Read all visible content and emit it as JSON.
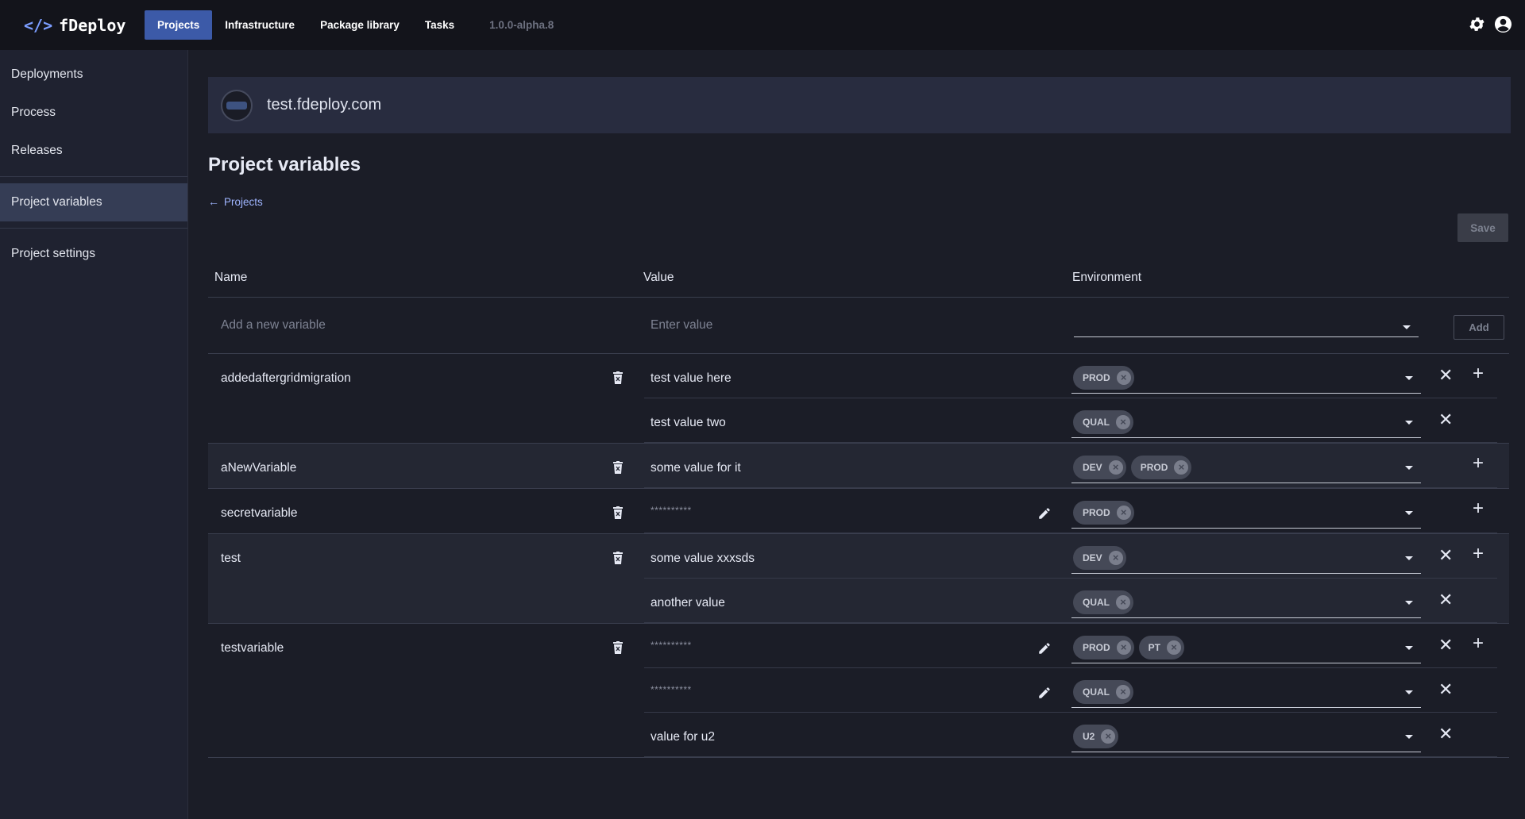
{
  "app": {
    "name": "fDeploy",
    "logo_glyph": "</>"
  },
  "nav": {
    "items": [
      {
        "label": "Projects",
        "active": true
      },
      {
        "label": "Infrastructure",
        "active": false
      },
      {
        "label": "Package library",
        "active": false
      },
      {
        "label": "Tasks",
        "active": false
      }
    ],
    "version": "1.0.0-alpha.8",
    "icons": [
      "gear-icon",
      "user-circle-icon"
    ]
  },
  "sidebar": {
    "items": [
      {
        "label": "Deployments"
      },
      {
        "label": "Process"
      },
      {
        "label": "Releases"
      },
      {
        "label": "Project variables",
        "active": true
      },
      {
        "label": "Project settings"
      }
    ]
  },
  "project": {
    "name": "test.fdeploy.com"
  },
  "page": {
    "title": "Project variables",
    "breadcrumb": "Projects",
    "save_label": "Save"
  },
  "table": {
    "headers": {
      "name": "Name",
      "value": "Value",
      "environment": "Environment"
    },
    "new_row": {
      "name_placeholder": "Add a new variable",
      "value_placeholder": "Enter value",
      "add_label": "Add"
    },
    "variables": [
      {
        "name": "addedaftergridmigration",
        "values": [
          {
            "value": "test value here",
            "secret": false,
            "environments": [
              "PROD"
            ]
          },
          {
            "value": "test value two",
            "secret": false,
            "environments": [
              "QUAL"
            ]
          }
        ]
      },
      {
        "name": "aNewVariable",
        "values": [
          {
            "value": "some value for it",
            "secret": false,
            "environments": [
              "DEV",
              "PROD"
            ]
          }
        ]
      },
      {
        "name": "secretvariable",
        "values": [
          {
            "value": "**********",
            "secret": true,
            "environments": [
              "PROD"
            ]
          }
        ]
      },
      {
        "name": "test",
        "values": [
          {
            "value": "some value xxxsds",
            "secret": false,
            "environments": [
              "DEV"
            ]
          },
          {
            "value": "another value",
            "secret": false,
            "environments": [
              "QUAL"
            ]
          }
        ]
      },
      {
        "name": "testvariable",
        "values": [
          {
            "value": "**********",
            "secret": true,
            "environments": [
              "PROD",
              "PT"
            ]
          },
          {
            "value": "**********",
            "secret": true,
            "environments": [
              "QUAL"
            ]
          },
          {
            "value": "value for u2",
            "secret": false,
            "environments": [
              "U2"
            ]
          }
        ]
      }
    ]
  },
  "colors": {
    "accent": "#3c5aa8",
    "link": "#9fb5ff",
    "background": "#1b1d27",
    "topbar": "#13141b",
    "sidebar": "#1f2230"
  }
}
